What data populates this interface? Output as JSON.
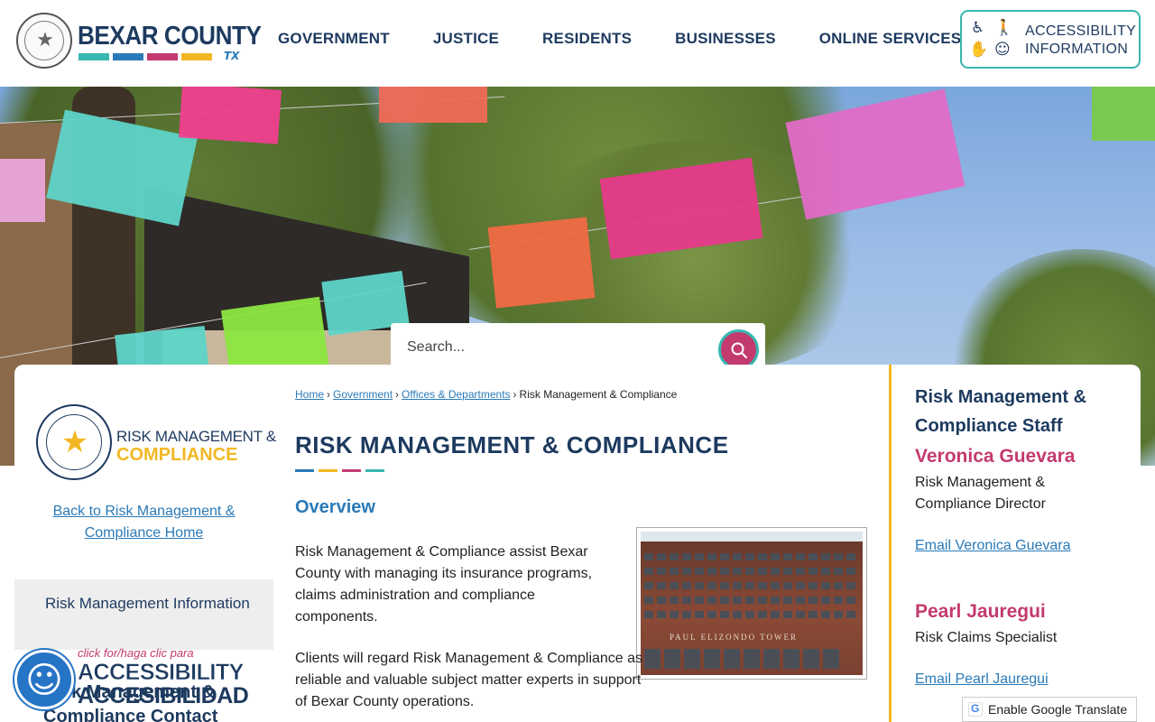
{
  "brand": {
    "logo_name": "BEXAR COUNTY",
    "logo_suffix": "TX",
    "bar_colors": [
      "#37b7b1",
      "#2a7ab8",
      "#c33a6f",
      "#f2b824"
    ]
  },
  "nav": {
    "items": [
      {
        "label": "GOVERNMENT"
      },
      {
        "label": "JUSTICE"
      },
      {
        "label": "RESIDENTS"
      },
      {
        "label": "BUSINESSES"
      },
      {
        "label": "ONLINE SERVICES"
      }
    ]
  },
  "accessibility_button": {
    "line1": "ACCESSIBILITY",
    "line2": "INFORMATION",
    "icons": [
      "wheelchair-icon",
      "walking-cane-icon",
      "sign-language-icon",
      "head-gear-icon"
    ]
  },
  "search": {
    "placeholder": "Search...",
    "button_icon": "search-icon"
  },
  "department": {
    "logo_line1": "RISK MANAGEMENT &",
    "logo_line2": "COMPLIANCE",
    "back_link": "Back to Risk Management & Compliance Home"
  },
  "sidebar": {
    "items": [
      {
        "label": "Risk Management Information"
      },
      {
        "label": "Risk Management & Compliance Contact"
      }
    ]
  },
  "accessibility_widget": {
    "small": "click for/haga clic para",
    "line1": "ACCESSIBILITY",
    "line2": "ACCESIBILIDAD"
  },
  "breadcrumb": {
    "items": [
      "Home",
      "Government",
      "Offices & Departments"
    ],
    "current": "Risk Management & Compliance"
  },
  "main": {
    "title": "RISK MANAGEMENT & COMPLIANCE",
    "section_title": "Overview",
    "paragraph1": "Risk Management & Compliance assist Bexar County with managing its insurance programs, claims  administration and compliance components.",
    "paragraph2": "Clients will regard Risk Management & Compliance as reliable and valuable subject matter experts in support of Bexar County operations.",
    "photo_label": "PAUL ELIZONDO TOWER"
  },
  "staff": {
    "heading": "Risk Management & Compliance Staff",
    "people": [
      {
        "name": "Veronica Guevara",
        "role": "Risk Management & Compliance Director",
        "email_label": "Email Veronica Guevara"
      },
      {
        "name": "Pearl Jauregui",
        "role": "Risk Claims Specialist",
        "email_label": "Email Pearl Jauregui"
      }
    ]
  },
  "translate": {
    "label": "Enable Google Translate"
  },
  "colors": {
    "navy": "#1d3a5f",
    "teal": "#37b7b1",
    "blue": "#2a7ab8",
    "magenta": "#c33a6f",
    "gold": "#f2b824"
  }
}
